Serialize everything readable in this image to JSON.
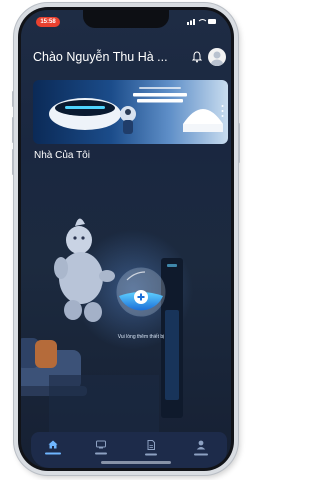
{
  "status_bar": {
    "time": "15:58"
  },
  "header": {
    "greeting": "Chào Nguyễn Thu Hà ..."
  },
  "home": {
    "title": "Nhà Của Tôi",
    "add_device": "Vui lòng thêm thiết bị"
  },
  "colors": {
    "time_pill": "#e9412f",
    "screen_bg": "#1e2c44",
    "nav_bg": "#1d2b4a",
    "nav_active": "#6fb6ff"
  },
  "bottom_nav": [
    {
      "icon": "home-icon",
      "active": true
    },
    {
      "icon": "devices-icon",
      "active": false
    },
    {
      "icon": "document-icon",
      "active": false
    },
    {
      "icon": "user-icon",
      "active": false
    }
  ]
}
